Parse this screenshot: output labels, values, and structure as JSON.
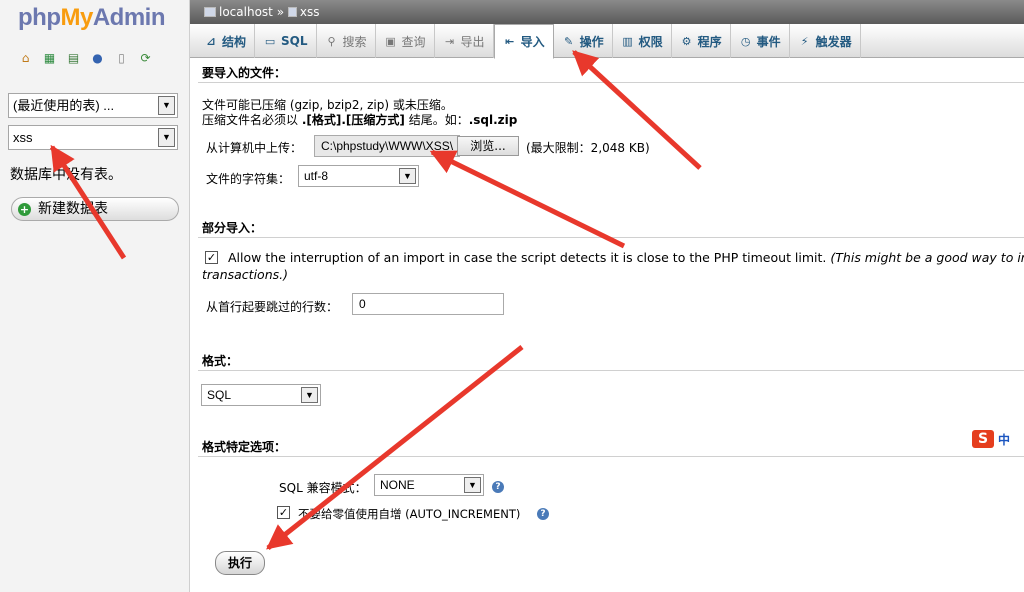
{
  "app": {
    "logo_php": "php",
    "logo_my": "My",
    "logo_admin": "Admin"
  },
  "sidebar": {
    "icons": [
      "home-icon",
      "table-icon",
      "query-icon",
      "help-icon",
      "docs-icon",
      "settings-icon"
    ],
    "recent_tables": "(最近使用的表) ...",
    "database_select": "xss",
    "no_tables": "数据库中没有表。",
    "new_table": "新建数据表"
  },
  "breadcrumb": {
    "server": "localhost",
    "sep": "»",
    "db": "xss"
  },
  "tabs": [
    {
      "label": "结构",
      "icon": "structure-icon",
      "disabled": false,
      "active": false
    },
    {
      "label": "SQL",
      "icon": "sql-icon",
      "disabled": false,
      "active": false
    },
    {
      "label": "搜索",
      "icon": "search-icon",
      "disabled": true,
      "active": false
    },
    {
      "label": "查询",
      "icon": "query-icon",
      "disabled": true,
      "active": false
    },
    {
      "label": "导出",
      "icon": "export-icon",
      "disabled": true,
      "active": false
    },
    {
      "label": "导入",
      "icon": "import-icon",
      "disabled": false,
      "active": true
    },
    {
      "label": "操作",
      "icon": "operations-icon",
      "disabled": false,
      "active": false
    },
    {
      "label": "权限",
      "icon": "privileges-icon",
      "disabled": false,
      "active": false
    },
    {
      "label": "程序",
      "icon": "routines-icon",
      "disabled": false,
      "active": false
    },
    {
      "label": "事件",
      "icon": "events-icon",
      "disabled": false,
      "active": false
    },
    {
      "label": "触发器",
      "icon": "triggers-icon",
      "disabled": false,
      "active": false
    }
  ],
  "import_file": {
    "title": "要导入的文件：",
    "note1": "文件可能已压缩 (gzip, bzip2, zip) 或未压缩。",
    "note2_prefix": "压缩文件名必须以 ",
    "note2_format": ".[格式].[压缩方式]",
    "note2_mid": " 结尾。如：",
    "note2_example": ".sql.zip",
    "upload_label": "从计算机中上传：",
    "file_path": "C:\\phpstudy\\WWW\\XSS\\",
    "browse": "浏览...",
    "max_limit": "(最大限制：2,048 KB)",
    "charset_label": "文件的字符集：",
    "charset_value": "utf-8"
  },
  "partial_import": {
    "title": "部分导入：",
    "allow_interrupt": "Allow the interruption of an import in case the script detects it is close to the PHP timeout limit.",
    "allow_interrupt_note_1": "(This might be a good way to import",
    "allow_interrupt_note_2": "transactions.)",
    "skip_label": "从首行起要跳过的行数：",
    "skip_value": "0"
  },
  "format": {
    "title": "格式：",
    "value": "SQL"
  },
  "format_options": {
    "title": "格式特定选项：",
    "compat_label": "SQL 兼容模式：",
    "compat_value": "NONE",
    "auto_increment_label": "不要给零值使用自增 (AUTO_INCREMENT)"
  },
  "go_button": "执行",
  "ime": {
    "label": "中"
  },
  "colors": {
    "annotation": "#e8382c",
    "accent": "#235a81"
  }
}
